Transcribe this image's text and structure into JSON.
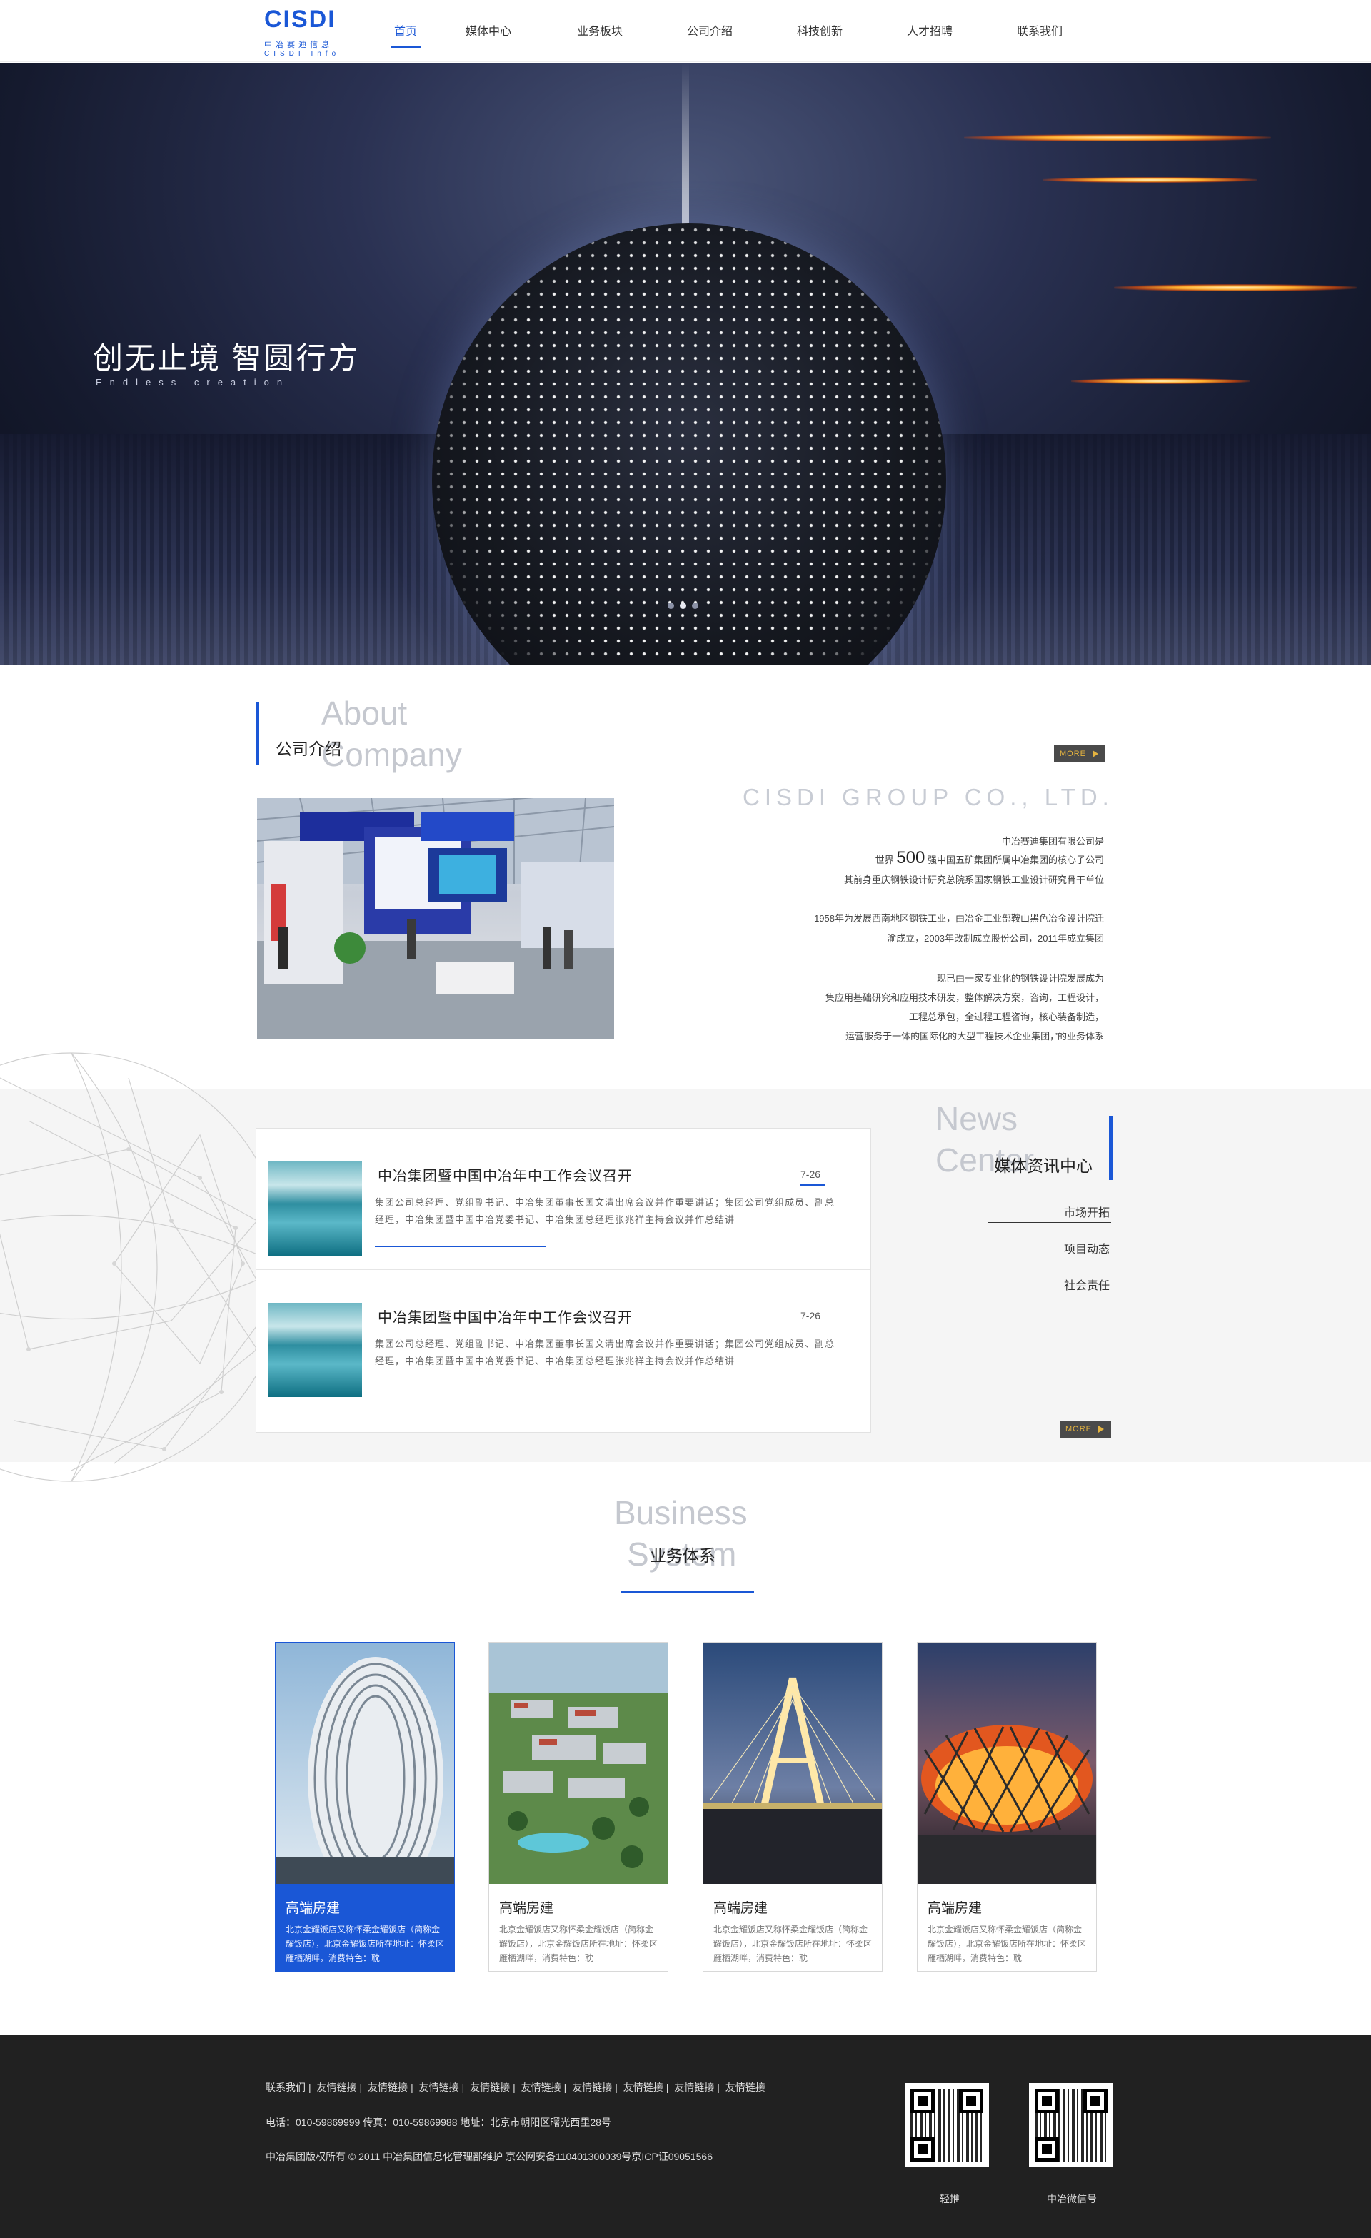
{
  "header": {
    "logo_text": "CISDI",
    "logo_cn": "中冶赛迪信息",
    "logo_en": "CISDI Info",
    "nav": [
      {
        "label": "首页",
        "active": true
      },
      {
        "label": "媒体中心"
      },
      {
        "label": "业务板块"
      },
      {
        "label": "公司介绍"
      },
      {
        "label": "科技创新"
      },
      {
        "label": "人才招聘"
      },
      {
        "label": "联系我们"
      }
    ]
  },
  "hero": {
    "title": "创无止境 智圆行方",
    "subtitle": "Endless creation",
    "slides": 3,
    "active_slide": 2
  },
  "about": {
    "heading_en_1": "About",
    "heading_en_2": "Company",
    "heading_cn": "公司介绍",
    "more_label": "MORE",
    "group_name": "CISDI GROUP CO., LTD.",
    "line1": "中冶赛迪集团有限公司是",
    "line2_pre": "世界",
    "line2_num": "500",
    "line2_post": "强中国五矿集团所属中冶集团的核心子公司",
    "line3": "其前身重庆钢铁设计研究总院系国家钢铁工业设计研究骨干单位",
    "line4": "1958年为发展西南地区钢铁工业，由冶金工业部鞍山黑色冶金设计院迁",
    "line5": "渝成立，2003年改制成立股份公司，2011年成立集团",
    "line6": "现已由一家专业化的钢铁设计院发展成为",
    "line7": "集应用基础研究和应用技术研发，整体解决方案，咨询，工程设计，",
    "line8": "工程总承包，全过程工程咨询，核心装备制造，",
    "line9": "运营服务于一体的国际化的大型工程技术企业集团，”的业务体系"
  },
  "news": {
    "heading_en_1": "News",
    "heading_en_2": "Center",
    "heading_cn": "媒体资讯中心",
    "more_label": "MORE",
    "categories": [
      "市场开拓",
      "项目动态",
      "社会责任"
    ],
    "items": [
      {
        "title": "中冶集团暨中国中冶年中工作会议召开",
        "date": "7-26",
        "body": "集团公司总经理、党组副书记、中冶集团董事长国文清出席会议并作重要讲话；集团公司党组成员、副总经理，中冶集团暨中国中冶党委书记、中冶集团总经理张兆祥主持会议并作总结讲"
      },
      {
        "title": "中冶集团暨中国中冶年中工作会议召开",
        "date": "7-26",
        "body": "集团公司总经理、党组副书记、中冶集团董事长国文清出席会议并作重要讲话；集团公司党组成员、副总经理，中冶集团暨中国中冶党委书记、中冶集团总经理张兆祥主持会议并作总结讲"
      }
    ]
  },
  "business": {
    "heading_en_1": "Business",
    "heading_en_2": "System",
    "heading_cn": "业务体系",
    "cards": [
      {
        "title": "高端房建",
        "desc": "北京金耀饭店又称怀柔金耀饭店（简称金耀饭店），北京金耀饭店所在地址：怀柔区雁栖湖畔，消费特色：耽",
        "active": true
      },
      {
        "title": "高端房建",
        "desc": "北京金耀饭店又称怀柔金耀饭店（简称金耀饭店），北京金耀饭店所在地址：怀柔区雁栖湖畔，消费特色：耽"
      },
      {
        "title": "高端房建",
        "desc": "北京金耀饭店又称怀柔金耀饭店（简称金耀饭店），北京金耀饭店所在地址：怀柔区雁栖湖畔，消费特色：耽"
      },
      {
        "title": "高端房建",
        "desc": "北京金耀饭店又称怀柔金耀饭店（简称金耀饭店），北京金耀饭店所在地址：怀柔区雁栖湖畔，消费特色：耽"
      }
    ]
  },
  "footer": {
    "links": [
      "联系我们",
      "友情链接",
      "友情链接",
      "友情链接",
      "友情链接",
      "友情链接",
      "友情链接",
      "友情链接",
      "友情链接",
      "友情链接"
    ],
    "contact": "电话：010-59869999 传真：010-59869988 地址：北京市朝阳区曙光西里28号",
    "copyright": "中冶集团版权所有 © 2011 中冶集团信息化管理部维护 京公网安备110401300039号京ICP证09051566",
    "qr_labels": [
      "轻推",
      "中冶微信号"
    ]
  },
  "colors": {
    "accent": "#1a57d6",
    "footer_bg": "#212121",
    "more_bg": "#4a4a4a",
    "more_text": "#e4b340"
  }
}
